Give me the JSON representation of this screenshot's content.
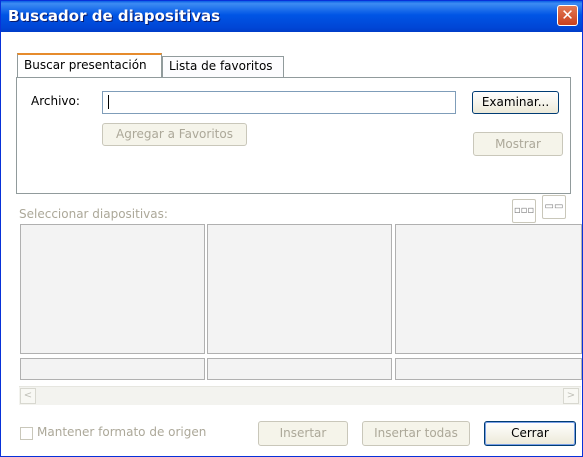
{
  "window": {
    "title": "Buscador de diapositivas",
    "close_glyph": "✕"
  },
  "tabs": [
    {
      "label": "Buscar presentación",
      "active": true
    },
    {
      "label": "Lista de favoritos",
      "active": false
    }
  ],
  "search_panel": {
    "file_label": "Archivo:",
    "file_value": "",
    "browse_button": "Examinar...",
    "add_favorites_button": "Agregar a Favoritos",
    "show_button": "Mostrar"
  },
  "slides_section": {
    "label": "Seleccionar diapositivas:",
    "view_buttons": [
      {
        "icon": "small-thumbnails-icon",
        "glyph": "▫▫▫"
      },
      {
        "icon": "large-thumbnails-icon",
        "glyph": "▭▭"
      }
    ],
    "scroll_left_glyph": "<",
    "scroll_right_glyph": ">"
  },
  "footer": {
    "keep_format_label": "Mantener formato de origen",
    "keep_format_checked": false,
    "insert_button": "Insertar",
    "insert_all_button": "Insertar todas",
    "close_button": "Cerrar"
  }
}
